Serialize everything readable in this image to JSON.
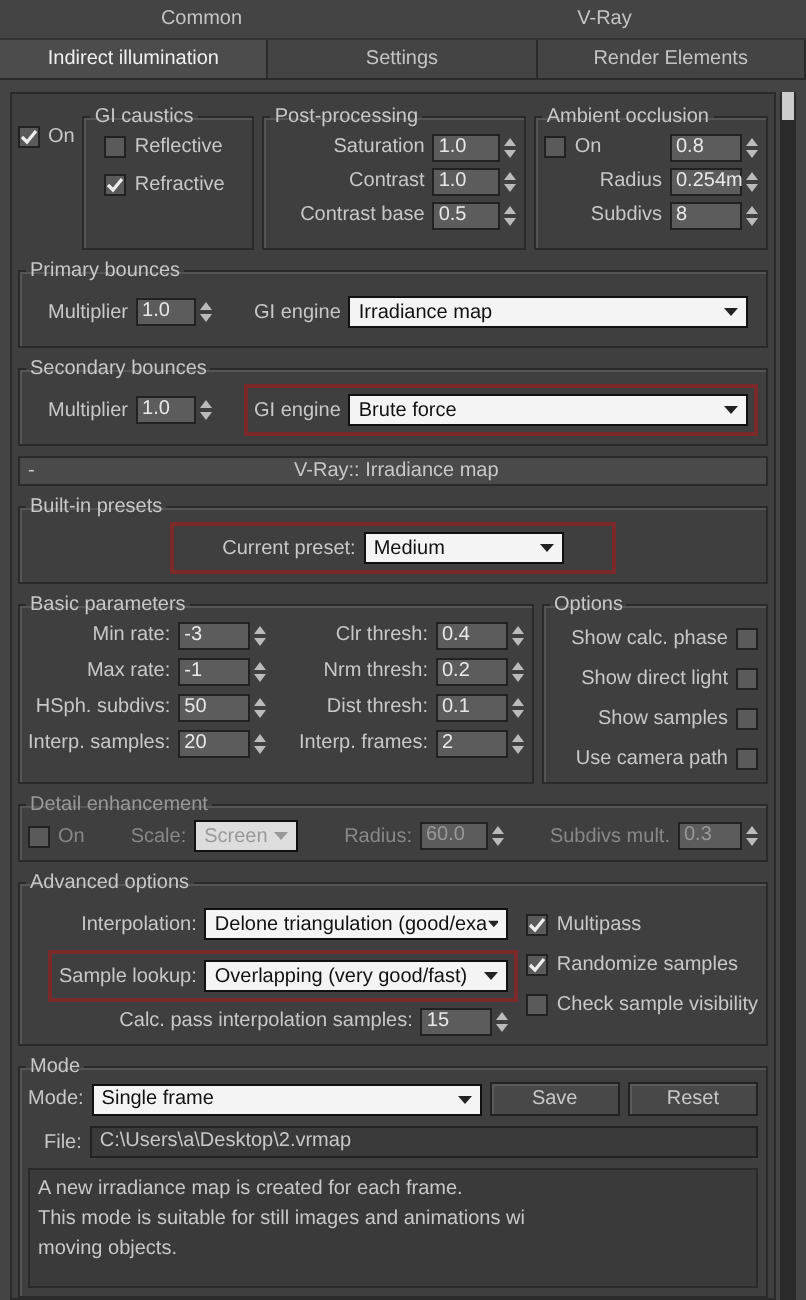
{
  "tabs": [
    {
      "label": "Common",
      "selected": false
    },
    {
      "label": "V-Ray",
      "selected": false
    },
    {
      "label": "Indirect illumination",
      "selected": true
    },
    {
      "label": "Settings",
      "selected": false
    },
    {
      "label": "Render Elements",
      "selected": false
    }
  ],
  "gi": {
    "on": {
      "label": "On",
      "checked": true
    },
    "caustics": {
      "title": "GI caustics",
      "items": [
        {
          "label": "Reflective",
          "checked": false
        },
        {
          "label": "Refractive",
          "checked": true
        }
      ]
    },
    "post": {
      "title": "Post-processing",
      "fields": [
        {
          "label": "Saturation",
          "value": "1.0"
        },
        {
          "label": "Contrast",
          "value": "1.0"
        },
        {
          "label": "Contrast base",
          "value": "0.5"
        }
      ]
    },
    "ao": {
      "title": "Ambient occlusion",
      "on": {
        "label": "On",
        "checked": false
      },
      "amount": "0.8",
      "fields": [
        {
          "label": "Radius",
          "value": "0.254m"
        },
        {
          "label": "Subdivs",
          "value": "8"
        }
      ]
    }
  },
  "primary": {
    "title": "Primary bounces",
    "multiplier": {
      "label": "Multiplier",
      "value": "1.0"
    },
    "engine": {
      "label": "GI engine",
      "value": "Irradiance map",
      "highlighted": false
    }
  },
  "secondary": {
    "title": "Secondary bounces",
    "multiplier": {
      "label": "Multiplier",
      "value": "1.0"
    },
    "engine": {
      "label": "GI engine",
      "value": "Brute force",
      "highlighted": true
    }
  },
  "rollout": {
    "sign": "-",
    "title": "V-Ray:: Irradiance map"
  },
  "presets": {
    "title": "Built-in presets",
    "label": "Current preset:",
    "value": "Medium",
    "highlighted": true
  },
  "basic": {
    "title": "Basic parameters",
    "left": [
      {
        "label": "Min rate:",
        "value": "-3"
      },
      {
        "label": "Max rate:",
        "value": "-1"
      },
      {
        "label": "HSph. subdivs:",
        "value": "50"
      },
      {
        "label": "Interp. samples:",
        "value": "20"
      }
    ],
    "right": [
      {
        "label": "Clr thresh:",
        "value": "0.4"
      },
      {
        "label": "Nrm thresh:",
        "value": "0.2"
      },
      {
        "label": "Dist thresh:",
        "value": "0.1"
      },
      {
        "label": "Interp. frames:",
        "value": "2"
      }
    ]
  },
  "options": {
    "title": "Options",
    "items": [
      {
        "label": "Show calc. phase",
        "checked": false
      },
      {
        "label": "Show direct light",
        "checked": false
      },
      {
        "label": "Show samples",
        "checked": false
      },
      {
        "label": "Use camera path",
        "checked": false
      }
    ]
  },
  "detail": {
    "title": "Detail enhancement",
    "disabled": true,
    "on": {
      "label": "On",
      "checked": false
    },
    "scale": {
      "label": "Scale:",
      "value": "Screen"
    },
    "radius": {
      "label": "Radius:",
      "value": "60.0"
    },
    "subdivs_mult": {
      "label": "Subdivs mult.",
      "value": "0.3"
    }
  },
  "advanced": {
    "title": "Advanced options",
    "interpolation": {
      "label": "Interpolation:",
      "value": "Delone triangulation (good/exa",
      "highlighted": false
    },
    "lookup": {
      "label": "Sample lookup:",
      "value": "Overlapping (very good/fast)",
      "highlighted": true
    },
    "calc": {
      "label": "Calc. pass interpolation samples:",
      "value": "15"
    },
    "checks": [
      {
        "label": "Multipass",
        "checked": true
      },
      {
        "label": "Randomize samples",
        "checked": true
      },
      {
        "label": "Check sample visibility",
        "checked": false
      }
    ]
  },
  "mode": {
    "title": "Mode",
    "mode": {
      "label": "Mode:",
      "value": "Single frame"
    },
    "buttons": [
      "Save",
      "Reset"
    ],
    "file": {
      "label": "File:",
      "value": "C:\\Users\\a\\Desktop\\2.vrmap"
    },
    "description": [
      "A new irradiance map is created for each frame.",
      "This mode is suitable for still images and animations wi",
      "moving objects."
    ]
  }
}
